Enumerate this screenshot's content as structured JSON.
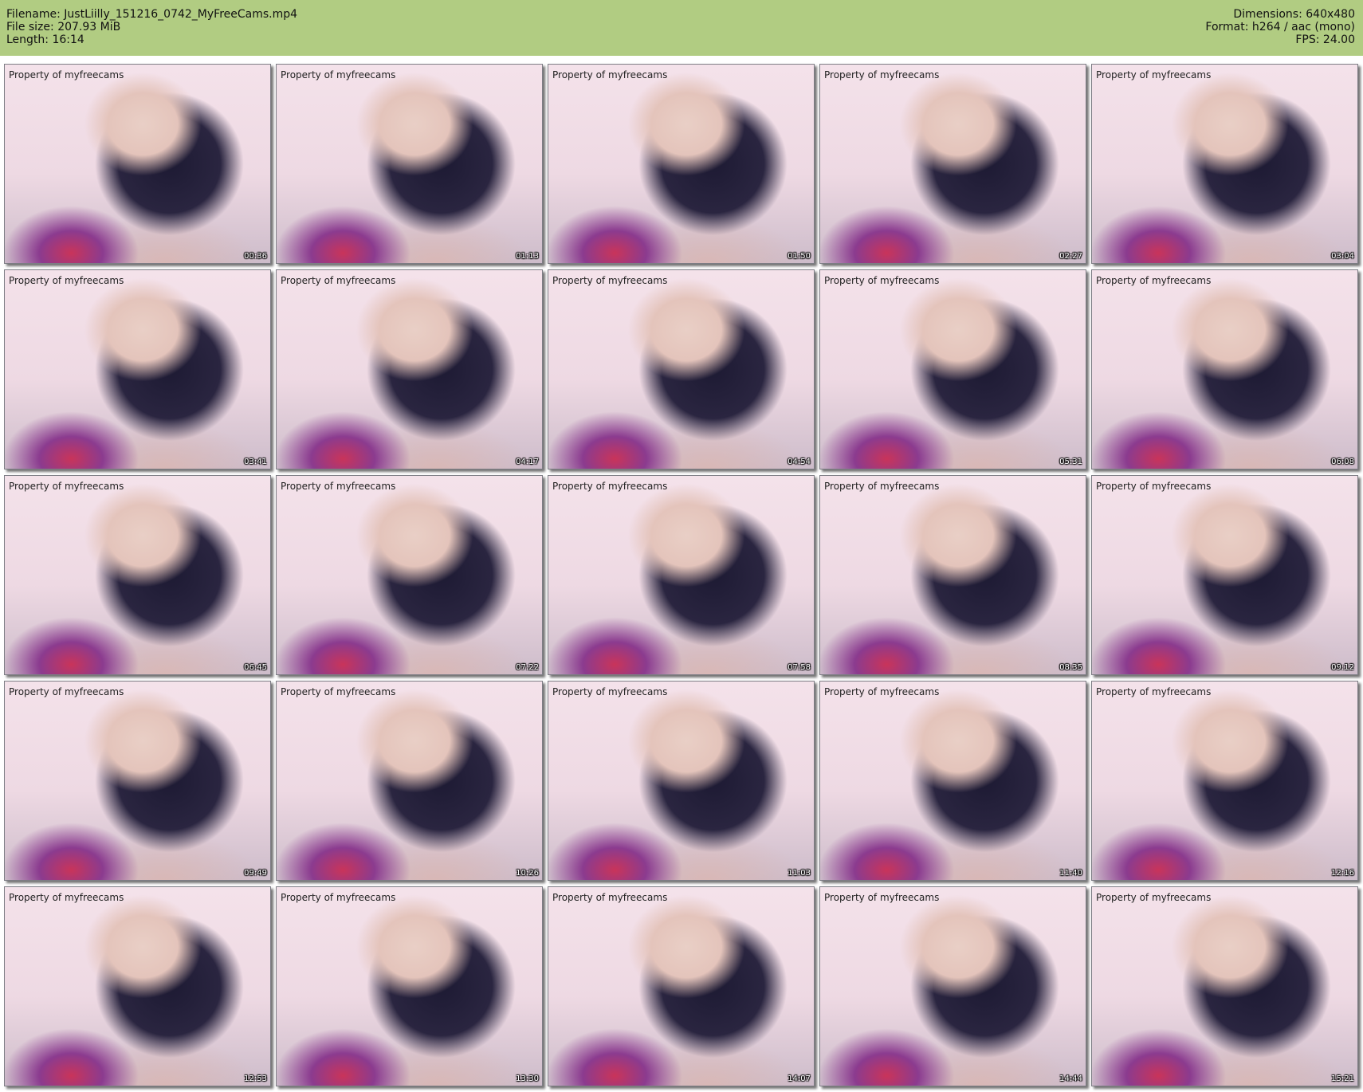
{
  "header": {
    "left_lines": [
      "Filename: JustLiilly_151216_0742_MyFreeCams.mp4",
      "File size: 207.93 MiB",
      "Length: 16:14"
    ],
    "right_lines": [
      "Dimensions: 640x480",
      "Format: h264 / aac (mono)",
      "FPS: 24.00"
    ]
  },
  "watermark": "Property of myfreecams",
  "thumbnails": [
    "00:36",
    "01:13",
    "01:50",
    "02:27",
    "03:04",
    "03:41",
    "04:17",
    "04:54",
    "05:31",
    "06:08",
    "06:45",
    "07:22",
    "07:58",
    "08:35",
    "09:12",
    "09:49",
    "10:26",
    "11:03",
    "11:40",
    "12:16",
    "12:53",
    "13:30",
    "14:07",
    "14:44",
    "15:21"
  ],
  "colors": {
    "header_bg": "#b1cc82"
  }
}
